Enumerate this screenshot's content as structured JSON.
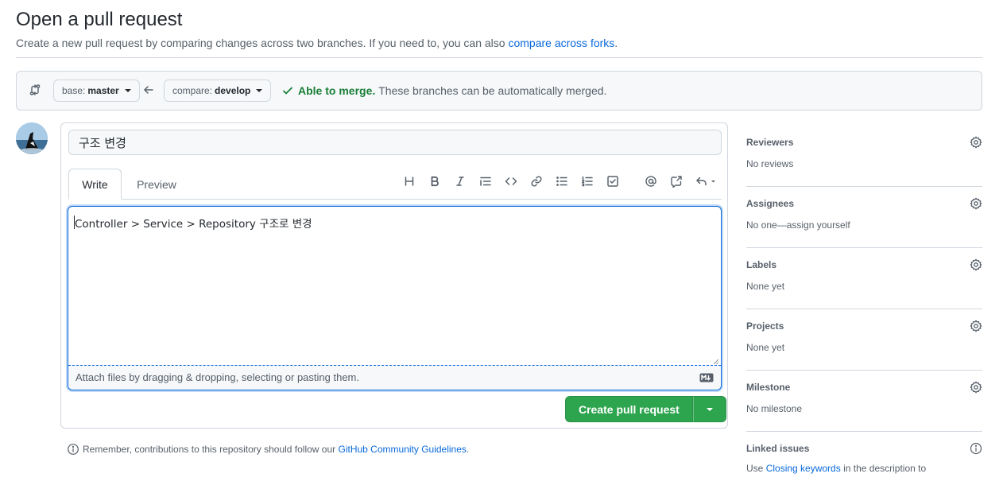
{
  "header": {
    "title": "Open a pull request",
    "subtitle": "Create a new pull request by comparing changes across two branches. If you need to, you can also",
    "subtitle_link": "compare across forks",
    "subtitle_end": "."
  },
  "range": {
    "base_prefix": "base:",
    "base_branch": "master",
    "compare_prefix": "compare:",
    "compare_branch": "develop",
    "merge_ok": "Able to merge.",
    "merge_text": "These branches can be automatically merged."
  },
  "form": {
    "title_value": "구조 변경",
    "tabs": [
      {
        "label": "Write"
      },
      {
        "label": "Preview"
      }
    ],
    "toolbar_icons": [
      "heading-icon",
      "bold-icon",
      "italic-icon",
      "quote-icon",
      "code-icon",
      "link-icon",
      "unordered-list-icon",
      "ordered-list-icon",
      "task-list-icon",
      "mention-icon",
      "reference-icon",
      "reply-icon"
    ],
    "body_value": "Controller > Service > Repository 구조로 변경",
    "attach_text": "Attach files by dragging & dropping, selecting or pasting them.",
    "submit_label": "Create pull request"
  },
  "footer": {
    "text": "Remember, contributions to this repository should follow our",
    "link": "GitHub Community Guidelines",
    "end": "."
  },
  "sidebar": {
    "sections": [
      {
        "heading": "Reviewers",
        "value": "No reviews"
      },
      {
        "heading": "Assignees",
        "value": "No one—assign yourself"
      },
      {
        "heading": "Labels",
        "value": "None yet"
      },
      {
        "heading": "Projects",
        "value": "None yet"
      },
      {
        "heading": "Milestone",
        "value": "No milestone"
      },
      {
        "heading": "Linked issues",
        "value_prefix": "Use",
        "value_link": "Closing keywords",
        "value_suffix": "in the description to"
      }
    ]
  },
  "colors": {
    "accent": "#0969da",
    "success": "#2da44e",
    "merge_text": "#1a7f37"
  }
}
